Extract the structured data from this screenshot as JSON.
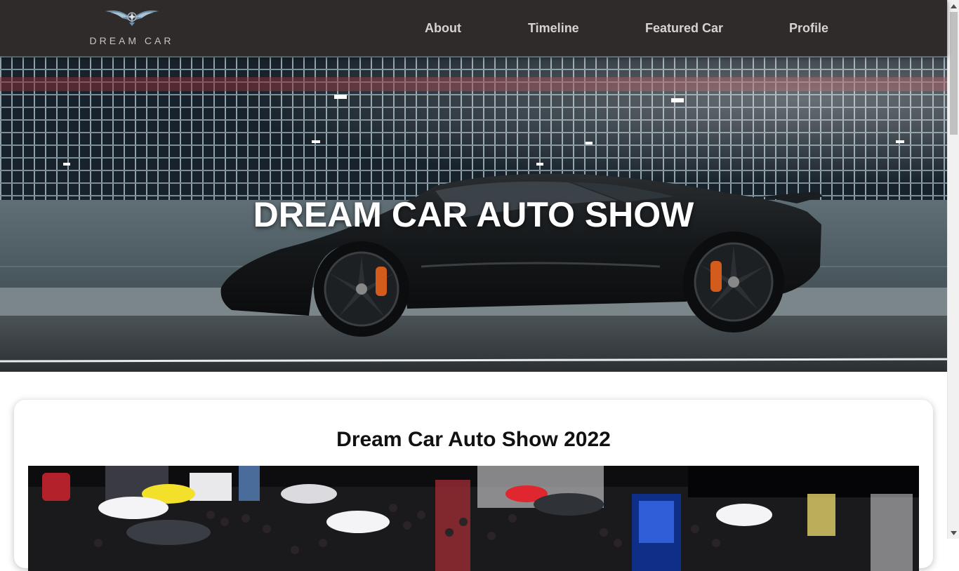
{
  "brand": {
    "name": "DREAM CAR",
    "logo_icon": "winged-emblem-icon"
  },
  "nav": {
    "items": [
      {
        "label": "About"
      },
      {
        "label": "Timeline"
      },
      {
        "label": "Featured Car"
      },
      {
        "label": "Profile"
      }
    ]
  },
  "hero": {
    "title": "DREAM CAR AUTO SHOW",
    "image": "black-sports-car-photo"
  },
  "section": {
    "title": "Dream Car Auto Show 2022",
    "image": "auto-show-crowd-photo"
  },
  "colors": {
    "navbar_bg": "#2f2b2b",
    "nav_text": "#d9d2d2",
    "hero_title": "#ffffff"
  }
}
